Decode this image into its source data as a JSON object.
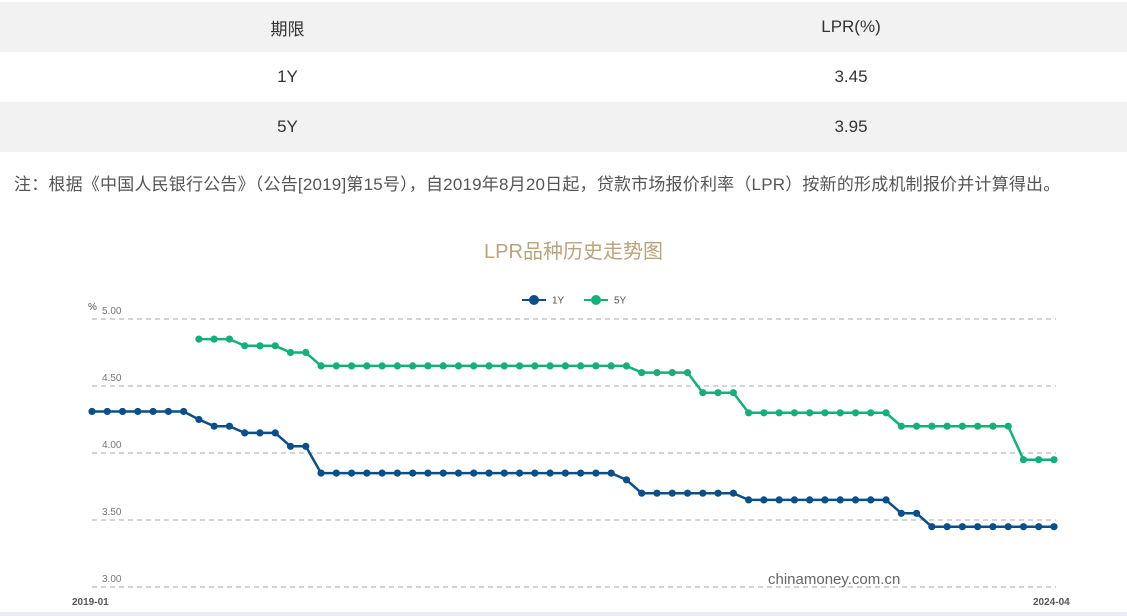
{
  "table": {
    "headers": [
      "期限",
      "LPR(%)"
    ],
    "rows": [
      {
        "term": "1Y",
        "rate": "3.45"
      },
      {
        "term": "5Y",
        "rate": "3.95"
      }
    ]
  },
  "note": "注：根据《中国人民银行公告》（公告[2019]第15号），自2019年8月20日起，贷款市场报价利率（LPR）按新的形成机制报价并计算得出。",
  "chart_data": {
    "type": "line",
    "title": "LPR品种历史走势图",
    "ylabel": "%",
    "ylim": [
      3.0,
      5.0
    ],
    "yticks": [
      "5.00",
      "4.50",
      "4.00",
      "3.50",
      "3.00"
    ],
    "x_start_label": "2019-01",
    "x_end_label": "2024-04",
    "legend_position": "top-center",
    "grid": "dashed horizontal",
    "watermark": "chinamoney.com.cn",
    "colors": {
      "1Y": "#0a4f8a",
      "5Y": "#14b07a"
    },
    "x_dates": [
      "2019-01",
      "2019-02",
      "2019-03",
      "2019-04",
      "2019-05",
      "2019-06",
      "2019-07",
      "2019-08",
      "2019-09",
      "2019-10",
      "2019-11",
      "2019-12",
      "2020-01",
      "2020-02",
      "2020-03",
      "2020-04",
      "2020-05",
      "2020-06",
      "2020-07",
      "2020-08",
      "2020-09",
      "2020-10",
      "2020-11",
      "2020-12",
      "2021-01",
      "2021-02",
      "2021-03",
      "2021-04",
      "2021-05",
      "2021-06",
      "2021-07",
      "2021-08",
      "2021-09",
      "2021-10",
      "2021-11",
      "2021-12",
      "2022-01",
      "2022-02",
      "2022-03",
      "2022-04",
      "2022-05",
      "2022-06",
      "2022-07",
      "2022-08",
      "2022-09",
      "2022-10",
      "2022-11",
      "2022-12",
      "2023-01",
      "2023-02",
      "2023-03",
      "2023-04",
      "2023-05",
      "2023-06",
      "2023-07",
      "2023-08",
      "2023-09",
      "2023-10",
      "2023-11",
      "2023-12",
      "2024-01",
      "2024-02",
      "2024-03",
      "2024-04"
    ],
    "series": [
      {
        "name": "1Y",
        "points": [
          [
            "2019-01",
            4.31
          ],
          [
            "2019-02",
            4.31
          ],
          [
            "2019-03",
            4.31
          ],
          [
            "2019-04",
            4.31
          ],
          [
            "2019-05",
            4.31
          ],
          [
            "2019-06",
            4.31
          ],
          [
            "2019-07",
            4.31
          ],
          [
            "2019-08",
            4.25
          ],
          [
            "2019-09",
            4.2
          ],
          [
            "2019-10",
            4.2
          ],
          [
            "2019-11",
            4.15
          ],
          [
            "2019-12",
            4.15
          ],
          [
            "2020-01",
            4.15
          ],
          [
            "2020-02",
            4.05
          ],
          [
            "2020-03",
            4.05
          ],
          [
            "2020-04",
            3.85
          ],
          [
            "2020-05",
            3.85
          ],
          [
            "2020-06",
            3.85
          ],
          [
            "2020-07",
            3.85
          ],
          [
            "2020-08",
            3.85
          ],
          [
            "2020-09",
            3.85
          ],
          [
            "2020-10",
            3.85
          ],
          [
            "2020-11",
            3.85
          ],
          [
            "2020-12",
            3.85
          ],
          [
            "2021-01",
            3.85
          ],
          [
            "2021-02",
            3.85
          ],
          [
            "2021-03",
            3.85
          ],
          [
            "2021-04",
            3.85
          ],
          [
            "2021-05",
            3.85
          ],
          [
            "2021-06",
            3.85
          ],
          [
            "2021-07",
            3.85
          ],
          [
            "2021-08",
            3.85
          ],
          [
            "2021-09",
            3.85
          ],
          [
            "2021-10",
            3.85
          ],
          [
            "2021-11",
            3.85
          ],
          [
            "2021-12",
            3.8
          ],
          [
            "2022-01",
            3.7
          ],
          [
            "2022-02",
            3.7
          ],
          [
            "2022-03",
            3.7
          ],
          [
            "2022-04",
            3.7
          ],
          [
            "2022-05",
            3.7
          ],
          [
            "2022-06",
            3.7
          ],
          [
            "2022-07",
            3.7
          ],
          [
            "2022-08",
            3.65
          ],
          [
            "2022-09",
            3.65
          ],
          [
            "2022-10",
            3.65
          ],
          [
            "2022-11",
            3.65
          ],
          [
            "2022-12",
            3.65
          ],
          [
            "2023-01",
            3.65
          ],
          [
            "2023-02",
            3.65
          ],
          [
            "2023-03",
            3.65
          ],
          [
            "2023-04",
            3.65
          ],
          [
            "2023-05",
            3.65
          ],
          [
            "2023-06",
            3.55
          ],
          [
            "2023-07",
            3.55
          ],
          [
            "2023-08",
            3.45
          ],
          [
            "2023-09",
            3.45
          ],
          [
            "2023-10",
            3.45
          ],
          [
            "2023-11",
            3.45
          ],
          [
            "2023-12",
            3.45
          ],
          [
            "2024-01",
            3.45
          ],
          [
            "2024-02",
            3.45
          ],
          [
            "2024-03",
            3.45
          ],
          [
            "2024-04",
            3.45
          ]
        ]
      },
      {
        "name": "5Y",
        "points": [
          [
            "2019-08",
            4.85
          ],
          [
            "2019-09",
            4.85
          ],
          [
            "2019-10",
            4.85
          ],
          [
            "2019-11",
            4.8
          ],
          [
            "2019-12",
            4.8
          ],
          [
            "2020-01",
            4.8
          ],
          [
            "2020-02",
            4.75
          ],
          [
            "2020-03",
            4.75
          ],
          [
            "2020-04",
            4.65
          ],
          [
            "2020-05",
            4.65
          ],
          [
            "2020-06",
            4.65
          ],
          [
            "2020-07",
            4.65
          ],
          [
            "2020-08",
            4.65
          ],
          [
            "2020-09",
            4.65
          ],
          [
            "2020-10",
            4.65
          ],
          [
            "2020-11",
            4.65
          ],
          [
            "2020-12",
            4.65
          ],
          [
            "2021-01",
            4.65
          ],
          [
            "2021-02",
            4.65
          ],
          [
            "2021-03",
            4.65
          ],
          [
            "2021-04",
            4.65
          ],
          [
            "2021-05",
            4.65
          ],
          [
            "2021-06",
            4.65
          ],
          [
            "2021-07",
            4.65
          ],
          [
            "2021-08",
            4.65
          ],
          [
            "2021-09",
            4.65
          ],
          [
            "2021-10",
            4.65
          ],
          [
            "2021-11",
            4.65
          ],
          [
            "2021-12",
            4.65
          ],
          [
            "2022-01",
            4.6
          ],
          [
            "2022-02",
            4.6
          ],
          [
            "2022-03",
            4.6
          ],
          [
            "2022-04",
            4.6
          ],
          [
            "2022-05",
            4.45
          ],
          [
            "2022-06",
            4.45
          ],
          [
            "2022-07",
            4.45
          ],
          [
            "2022-08",
            4.3
          ],
          [
            "2022-09",
            4.3
          ],
          [
            "2022-10",
            4.3
          ],
          [
            "2022-11",
            4.3
          ],
          [
            "2022-12",
            4.3
          ],
          [
            "2023-01",
            4.3
          ],
          [
            "2023-02",
            4.3
          ],
          [
            "2023-03",
            4.3
          ],
          [
            "2023-04",
            4.3
          ],
          [
            "2023-05",
            4.3
          ],
          [
            "2023-06",
            4.2
          ],
          [
            "2023-07",
            4.2
          ],
          [
            "2023-08",
            4.2
          ],
          [
            "2023-09",
            4.2
          ],
          [
            "2023-10",
            4.2
          ],
          [
            "2023-11",
            4.2
          ],
          [
            "2023-12",
            4.2
          ],
          [
            "2024-01",
            4.2
          ],
          [
            "2024-02",
            3.95
          ],
          [
            "2024-03",
            3.95
          ],
          [
            "2024-04",
            3.95
          ]
        ]
      }
    ]
  }
}
